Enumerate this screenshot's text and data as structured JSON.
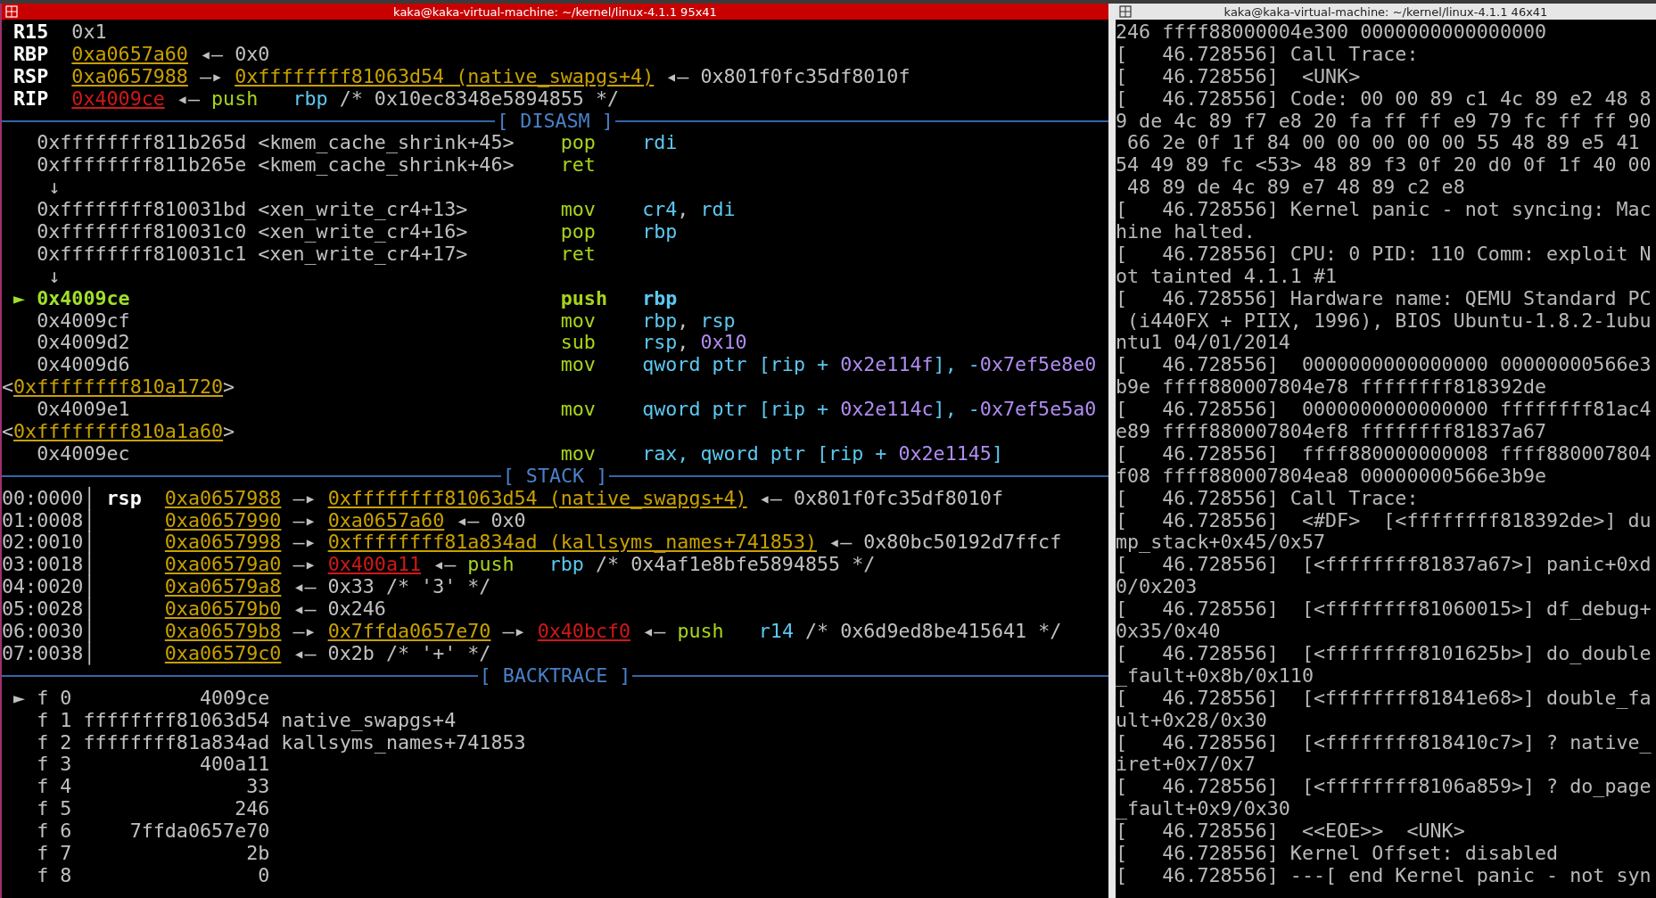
{
  "left_window": {
    "title": "kaka@kaka-virtual-machine: ~/kernel/linux-4.1.1 95x41",
    "lines": [
      {
        "kind": "text",
        "segs": [
          {
            "text": " R15  ",
            "kind": "label"
          },
          {
            "text": "0x1",
            "kind": "plain"
          }
        ]
      },
      {
        "kind": "text",
        "segs": [
          {
            "text": " RBP  ",
            "kind": "label"
          },
          {
            "text": "0xa0657a60",
            "kind": "addr"
          },
          {
            "text": " ◂— 0x0",
            "kind": "plain"
          }
        ]
      },
      {
        "kind": "text",
        "segs": [
          {
            "text": " RSP  ",
            "kind": "label"
          },
          {
            "text": "0xa0657988",
            "kind": "addr"
          },
          {
            "text": " —▸ ",
            "kind": "plain"
          },
          {
            "text": "0xffffffff81063d54 (native_swapgs+4)",
            "kind": "addr"
          },
          {
            "text": " ◂— 0x801f0fc35df8010f",
            "kind": "plain"
          }
        ]
      },
      {
        "kind": "text",
        "segs": [
          {
            "text": " RIP  ",
            "kind": "label"
          },
          {
            "text": "0x4009ce",
            "kind": "code"
          },
          {
            "text": " ◂— ",
            "kind": "plain"
          },
          {
            "text": "push   ",
            "kind": "op"
          },
          {
            "text": "rbp",
            "kind": "reg"
          },
          {
            "text": " /* 0x10ec8348e5894855 */",
            "kind": "plain"
          }
        ]
      },
      {
        "kind": "header",
        "label": "[ DISASM ]"
      },
      {
        "kind": "text",
        "segs": [
          {
            "text": "   0xffffffff811b265d <kmem_cache_shrink+45>    ",
            "kind": "plain"
          },
          {
            "text": "pop    ",
            "kind": "op"
          },
          {
            "text": "rdi",
            "kind": "reg"
          }
        ]
      },
      {
        "kind": "text",
        "segs": [
          {
            "text": "   0xffffffff811b265e <kmem_cache_shrink+46>    ",
            "kind": "plain"
          },
          {
            "text": "ret",
            "kind": "op"
          }
        ]
      },
      {
        "kind": "text",
        "segs": [
          {
            "text": "    ↓",
            "kind": "plain"
          }
        ]
      },
      {
        "kind": "text",
        "segs": [
          {
            "text": "   0xffffffff810031bd <xen_write_cr4+13>        ",
            "kind": "plain"
          },
          {
            "text": "mov    ",
            "kind": "op"
          },
          {
            "text": "cr4",
            "kind": "reg"
          },
          {
            "text": ", ",
            "kind": "plain"
          },
          {
            "text": "rdi",
            "kind": "reg"
          }
        ]
      },
      {
        "kind": "text",
        "segs": [
          {
            "text": "   0xffffffff810031c0 <xen_write_cr4+16>        ",
            "kind": "plain"
          },
          {
            "text": "pop    ",
            "kind": "op"
          },
          {
            "text": "rbp",
            "kind": "reg"
          }
        ]
      },
      {
        "kind": "text",
        "segs": [
          {
            "text": "   0xffffffff810031c1 <xen_write_cr4+17>        ",
            "kind": "plain"
          },
          {
            "text": "ret",
            "kind": "op"
          }
        ]
      },
      {
        "kind": "text",
        "segs": [
          {
            "text": "    ↓",
            "kind": "plain"
          }
        ]
      },
      {
        "kind": "text",
        "segs": [
          {
            "text": " ► 0x4009ce                                     ",
            "kind": "cur"
          },
          {
            "text": "push   ",
            "kind": "op_bold"
          },
          {
            "text": "rbp",
            "kind": "reg_bold"
          }
        ]
      },
      {
        "kind": "text",
        "segs": [
          {
            "text": "   0x4009cf                                     ",
            "kind": "plain"
          },
          {
            "text": "mov    ",
            "kind": "op"
          },
          {
            "text": "rbp",
            "kind": "reg"
          },
          {
            "text": ", ",
            "kind": "plain"
          },
          {
            "text": "rsp",
            "kind": "reg"
          }
        ]
      },
      {
        "kind": "text",
        "segs": [
          {
            "text": "   0x4009d2                                     ",
            "kind": "plain"
          },
          {
            "text": "sub    ",
            "kind": "op"
          },
          {
            "text": "rsp",
            "kind": "reg"
          },
          {
            "text": ", ",
            "kind": "plain"
          },
          {
            "text": "0x10",
            "kind": "num"
          }
        ]
      },
      {
        "kind": "text",
        "segs": [
          {
            "text": "   0x4009d6                                     ",
            "kind": "plain"
          },
          {
            "text": "mov    ",
            "kind": "op"
          },
          {
            "text": "qword ptr [rip + ",
            "kind": "reg"
          },
          {
            "text": "0x2e114f",
            "kind": "num"
          },
          {
            "text": "], -",
            "kind": "reg"
          },
          {
            "text": "0x7ef5e8e0",
            "kind": "num"
          }
        ]
      },
      {
        "kind": "text",
        "segs": [
          {
            "text": "<",
            "kind": "plain"
          },
          {
            "text": "0xffffffff810a1720",
            "kind": "addr"
          },
          {
            "text": ">",
            "kind": "plain"
          }
        ]
      },
      {
        "kind": "text",
        "segs": [
          {
            "text": "   0x4009e1                                     ",
            "kind": "plain"
          },
          {
            "text": "mov    ",
            "kind": "op"
          },
          {
            "text": "qword ptr [rip + ",
            "kind": "reg"
          },
          {
            "text": "0x2e114c",
            "kind": "num"
          },
          {
            "text": "], -",
            "kind": "reg"
          },
          {
            "text": "0x7ef5e5a0",
            "kind": "num"
          }
        ]
      },
      {
        "kind": "text",
        "segs": [
          {
            "text": "<",
            "kind": "plain"
          },
          {
            "text": "0xffffffff810a1a60",
            "kind": "addr"
          },
          {
            "text": ">",
            "kind": "plain"
          }
        ]
      },
      {
        "kind": "text",
        "segs": [
          {
            "text": "   0x4009ec                                     ",
            "kind": "plain"
          },
          {
            "text": "mov    ",
            "kind": "op"
          },
          {
            "text": "rax, qword ptr [rip + ",
            "kind": "reg"
          },
          {
            "text": "0x2e1145",
            "kind": "num"
          },
          {
            "text": "]",
            "kind": "reg"
          }
        ]
      },
      {
        "kind": "header",
        "label": "[ STACK ]"
      },
      {
        "kind": "text",
        "segs": [
          {
            "text": "00:0000│ ",
            "kind": "plain"
          },
          {
            "text": "rsp  ",
            "kind": "label"
          },
          {
            "text": "0xa0657988",
            "kind": "addr"
          },
          {
            "text": " —▸ ",
            "kind": "plain"
          },
          {
            "text": "0xffffffff81063d54 (native_swapgs+4)",
            "kind": "addr"
          },
          {
            "text": " ◂— 0x801f0fc35df8010f",
            "kind": "plain"
          }
        ]
      },
      {
        "kind": "text",
        "segs": [
          {
            "text": "01:0008│      ",
            "kind": "plain"
          },
          {
            "text": "0xa0657990",
            "kind": "addr"
          },
          {
            "text": " —▸ ",
            "kind": "plain"
          },
          {
            "text": "0xa0657a60",
            "kind": "addr"
          },
          {
            "text": " ◂— 0x0",
            "kind": "plain"
          }
        ]
      },
      {
        "kind": "text",
        "segs": [
          {
            "text": "02:0010│      ",
            "kind": "plain"
          },
          {
            "text": "0xa0657998",
            "kind": "addr"
          },
          {
            "text": " —▸ ",
            "kind": "plain"
          },
          {
            "text": "0xffffffff81a834ad (kallsyms_names+741853)",
            "kind": "addr"
          },
          {
            "text": " ◂— 0x80bc50192d7ffcf",
            "kind": "plain"
          }
        ]
      },
      {
        "kind": "text",
        "segs": [
          {
            "text": "03:0018│      ",
            "kind": "plain"
          },
          {
            "text": "0xa06579a0",
            "kind": "addr"
          },
          {
            "text": " —▸ ",
            "kind": "plain"
          },
          {
            "text": "0x400a11",
            "kind": "code"
          },
          {
            "text": " ◂— ",
            "kind": "plain"
          },
          {
            "text": "push   ",
            "kind": "op"
          },
          {
            "text": "rbp",
            "kind": "reg"
          },
          {
            "text": " /* 0x4af1e8bfe5894855 */",
            "kind": "plain"
          }
        ]
      },
      {
        "kind": "text",
        "segs": [
          {
            "text": "04:0020│      ",
            "kind": "plain"
          },
          {
            "text": "0xa06579a8",
            "kind": "addr"
          },
          {
            "text": " ◂— 0x33 /* '3' */",
            "kind": "plain"
          }
        ]
      },
      {
        "kind": "text",
        "segs": [
          {
            "text": "05:0028│      ",
            "kind": "plain"
          },
          {
            "text": "0xa06579b0",
            "kind": "addr"
          },
          {
            "text": " ◂— 0x246",
            "kind": "plain"
          }
        ]
      },
      {
        "kind": "text",
        "segs": [
          {
            "text": "06:0030│      ",
            "kind": "plain"
          },
          {
            "text": "0xa06579b8",
            "kind": "addr"
          },
          {
            "text": " —▸ ",
            "kind": "plain"
          },
          {
            "text": "0x7ffda0657e70",
            "kind": "addr"
          },
          {
            "text": " —▸ ",
            "kind": "plain"
          },
          {
            "text": "0x40bcf0",
            "kind": "code"
          },
          {
            "text": " ◂— ",
            "kind": "plain"
          },
          {
            "text": "push   ",
            "kind": "op"
          },
          {
            "text": "r14",
            "kind": "reg"
          },
          {
            "text": " /* 0x6d9ed8be415641 */",
            "kind": "plain"
          }
        ]
      },
      {
        "kind": "text",
        "segs": [
          {
            "text": "07:0038│      ",
            "kind": "plain"
          },
          {
            "text": "0xa06579c0",
            "kind": "addr"
          },
          {
            "text": " ◂— 0x2b /* '+' */",
            "kind": "plain"
          }
        ]
      },
      {
        "kind": "header",
        "label": "[ BACKTRACE ]"
      },
      {
        "kind": "text",
        "segs": [
          {
            "text": " ► f 0           4009ce",
            "kind": "plain"
          }
        ]
      },
      {
        "kind": "text",
        "segs": [
          {
            "text": "   f 1 ffffffff81063d54 native_swapgs+4",
            "kind": "plain"
          }
        ]
      },
      {
        "kind": "text",
        "segs": [
          {
            "text": "   f 2 ffffffff81a834ad kallsyms_names+741853",
            "kind": "plain"
          }
        ]
      },
      {
        "kind": "text",
        "segs": [
          {
            "text": "   f 3           400a11",
            "kind": "plain"
          }
        ]
      },
      {
        "kind": "text",
        "segs": [
          {
            "text": "   f 4               33",
            "kind": "plain"
          }
        ]
      },
      {
        "kind": "text",
        "segs": [
          {
            "text": "   f 5              246",
            "kind": "plain"
          }
        ]
      },
      {
        "kind": "text",
        "segs": [
          {
            "text": "   f 6     7ffda0657e70",
            "kind": "plain"
          }
        ]
      },
      {
        "kind": "text",
        "segs": [
          {
            "text": "   f 7               2b",
            "kind": "plain"
          }
        ]
      },
      {
        "kind": "text",
        "segs": [
          {
            "text": "   f 8                0",
            "kind": "plain"
          }
        ]
      }
    ]
  },
  "right_window": {
    "title": "kaka@kaka-virtual-machine: ~/kernel/linux-4.1.1 46x41",
    "lines": [
      "246 ffff88000004e300 0000000000000000",
      "[   46.728556] Call Trace:",
      "[   46.728556]  <UNK>",
      "[   46.728556] Code: 00 00 89 c1 4c 89 e2 48 8",
      "9 de 4c 89 f7 e8 20 fa ff ff e9 79 fc ff ff 90",
      " 66 2e 0f 1f 84 00 00 00 00 00 55 48 89 e5 41",
      "54 49 89 fc <53> 48 89 f3 0f 20 d0 0f 1f 40 00",
      " 48 89 de 4c 89 e7 48 89 c2 e8",
      "[   46.728556] Kernel panic - not syncing: Mac",
      "hine halted.",
      "[   46.728556] CPU: 0 PID: 110 Comm: exploit N",
      "ot tainted 4.1.1 #1",
      "[   46.728556] Hardware name: QEMU Standard PC",
      " (i440FX + PIIX, 1996), BIOS Ubuntu-1.8.2-1ubu",
      "ntu1 04/01/2014",
      "[   46.728556]  0000000000000000 00000000566e3",
      "b9e ffff880007804e78 ffffffff818392de",
      "[   46.728556]  0000000000000000 ffffffff81ac4",
      "e89 ffff880007804ef8 ffffffff81837a67",
      "[   46.728556]  ffff880000000008 ffff880007804",
      "f08 ffff880007804ea8 00000000566e3b9e",
      "[   46.728556] Call Trace:",
      "[   46.728556]  <#DF>  [<ffffffff818392de>] du",
      "mp_stack+0x45/0x57",
      "[   46.728556]  [<ffffffff81837a67>] panic+0xd",
      "0/0x203",
      "[   46.728556]  [<ffffffff81060015>] df_debug+",
      "0x35/0x40",
      "[   46.728556]  [<ffffffff8101625b>] do_double",
      "_fault+0x8b/0x110",
      "[   46.728556]  [<ffffffff81841e68>] double_fa",
      "ult+0x28/0x30",
      "[   46.728556]  [<ffffffff818410c7>] ? native_",
      "iret+0x7/0x7",
      "[   46.728556]  [<ffffffff8106a859>] ? do_page",
      "_fault+0x9/0x30",
      "[   46.728556]  <<EOE>>  <UNK>",
      "[   46.728556] Kernel Offset: disabled",
      "[   46.728556] ---[ end Kernel panic - not syn"
    ]
  }
}
